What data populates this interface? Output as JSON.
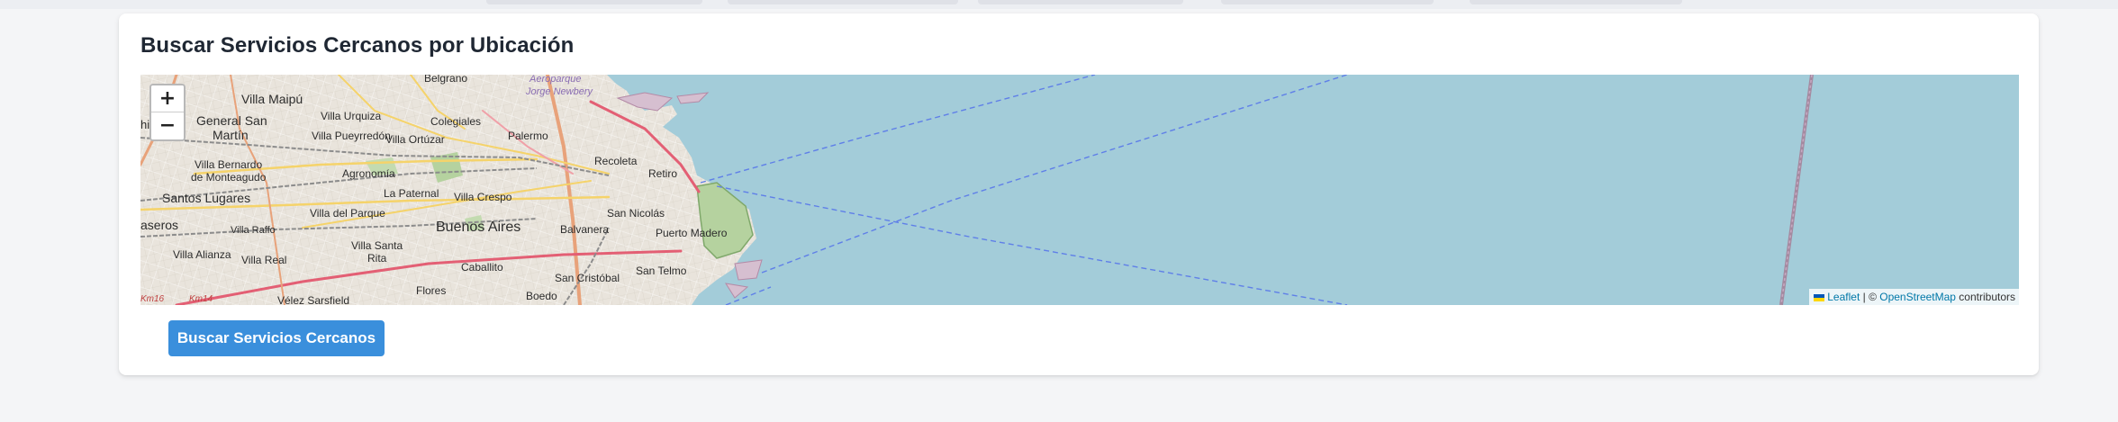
{
  "section": {
    "title": "Buscar Servicios Cercanos por Ubicación"
  },
  "map": {
    "zoom_in_label": "+",
    "zoom_out_label": "−",
    "attribution": {
      "leaflet_label": "Leaflet",
      "separator": " | © ",
      "osm_label": "OpenStreetMap",
      "suffix": " contributors"
    },
    "place_labels": {
      "villa_maipu": "Villa Maipú",
      "general_san_martin_1": "General San",
      "general_san_martin_2": "Martín",
      "villa_pueyrredon": "Villa Pueyrredón",
      "villa_urquiza": "Villa Urquiza",
      "colegiales": "Colegiales",
      "palermo": "Palermo",
      "belgrano": "Belgrano",
      "villa_ortuzar": "Villa Ortúzar",
      "villa_bernardo_1": "Villa Bernardo",
      "villa_bernardo_2": "de Monteagudo",
      "agronomia": "Agronomía",
      "la_paternal": "La Paternal",
      "villa_crespo": "Villa Crespo",
      "recoleta": "Recoleta",
      "retiro": "Retiro",
      "santos_lugares": "Santos Lugares",
      "villa_del_parque": "Villa del Parque",
      "san_nicolas": "San Nicolás",
      "buenos_aires": "Buenos Aires",
      "balvanera": "Balvanera",
      "puerto_madero": "Puerto Madero",
      "caseros": "aseros",
      "villa_raffo": "Villa Raffo",
      "villa_santa_rita_1": "Villa Santa",
      "villa_santa_rita_2": "Rita",
      "villa_alianza": "Villa Alianza",
      "villa_real": "Villa Real",
      "caballito": "Caballito",
      "san_cristobal": "San Cristóbal",
      "san_telmo": "San Telmo",
      "velez_sarsfield": "Vélez Sarsfield",
      "flores": "Flores",
      "boedo": "Boedo",
      "aeroparque_1": "Aeroparque",
      "aeroparque_2": "Jorge Newbery",
      "km16": "Km16",
      "km14": "Km14",
      "edge_hi": "hi"
    }
  },
  "actions": {
    "search_button_label": "Buscar Servicios Cercanos"
  },
  "colors": {
    "water": "#a3ccd9",
    "land": "#e9e4dc",
    "park": "#b5d29f",
    "primary_button": "#3a8fdc",
    "title_text": "#1f2733"
  }
}
